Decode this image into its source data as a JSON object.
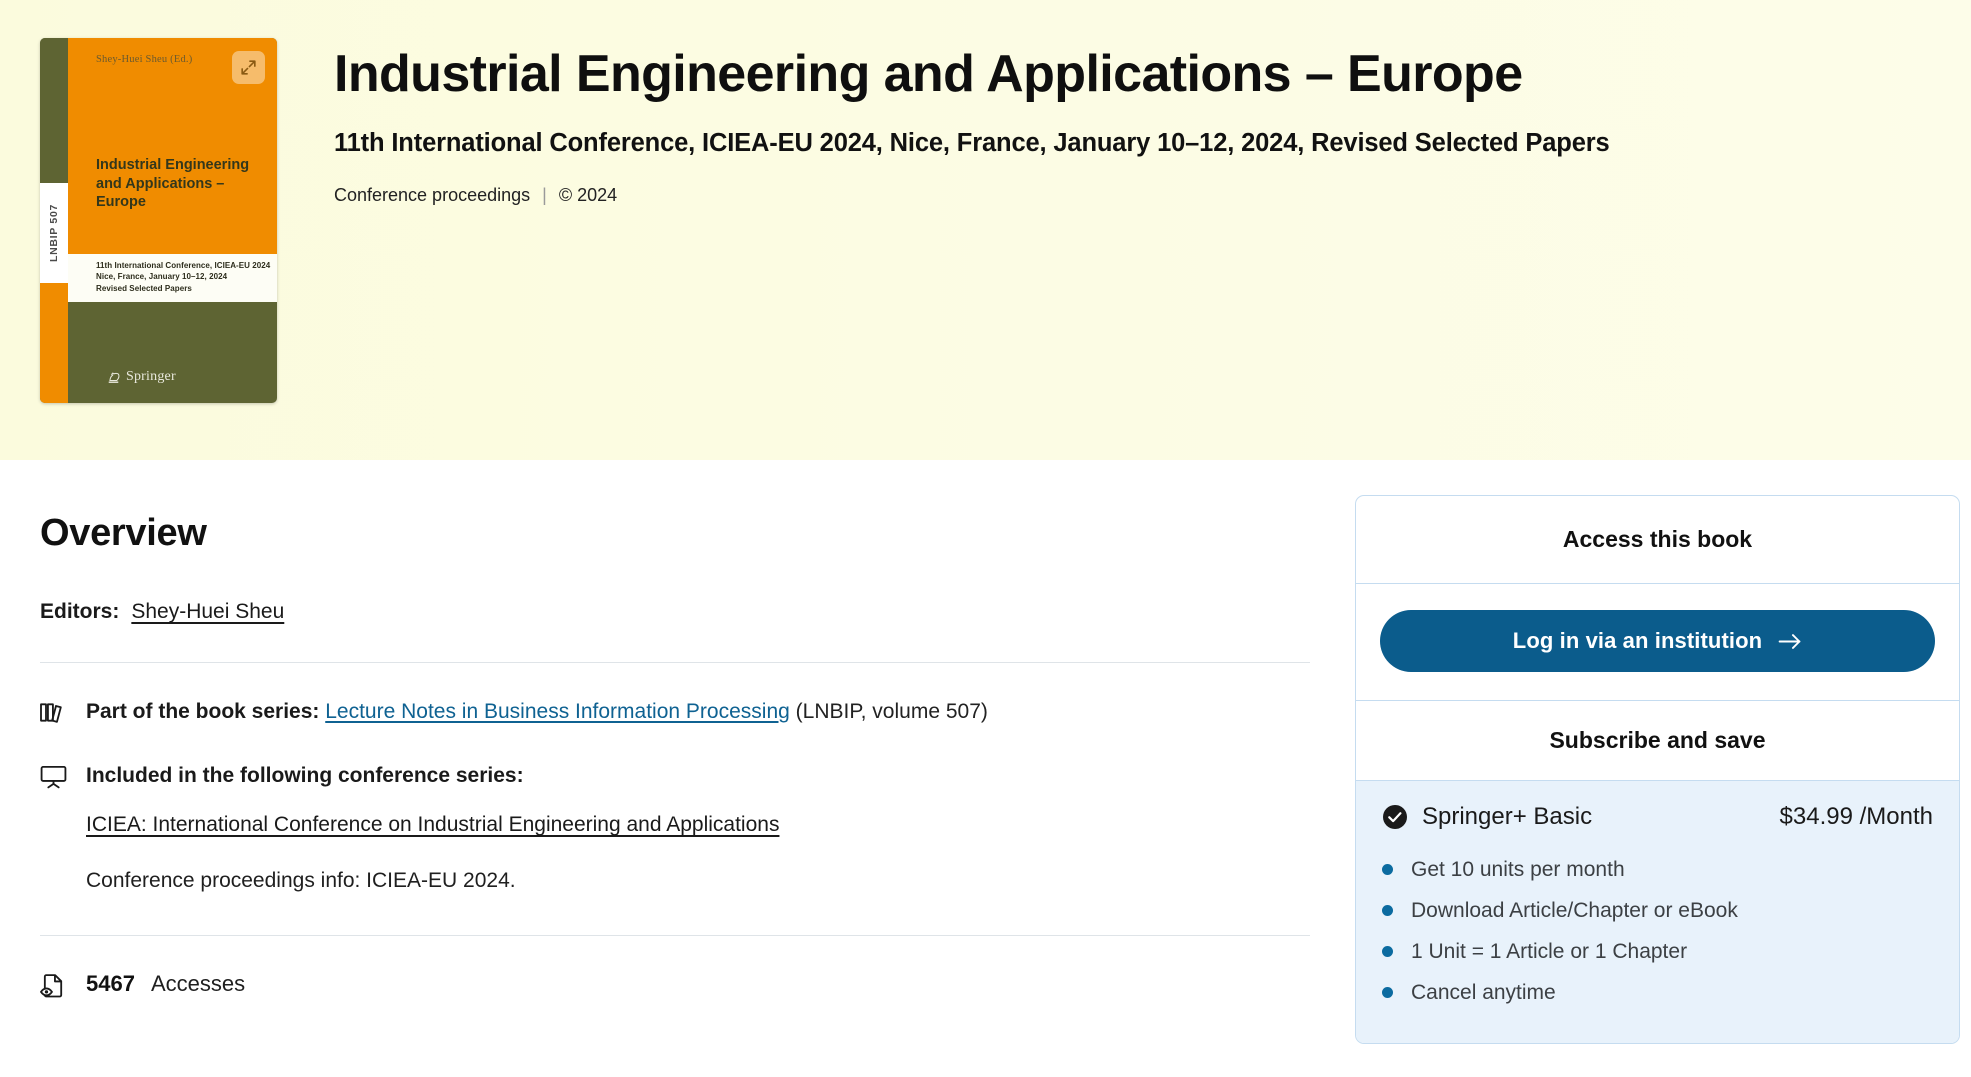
{
  "hero": {
    "title": "Industrial Engineering and Applications – Europe",
    "subtitle": "11th International Conference, ICIEA-EU 2024, Nice, France, January 10–12, 2024, Revised Selected Papers",
    "type_label": "Conference proceedings",
    "separator": "|",
    "copyright": "© 2024",
    "expand_icon": "expand-arrows-icon"
  },
  "cover": {
    "editor_credit": "Shey-Huei Sheu (Ed.)",
    "spine_label": "LNBIP 507",
    "title": "Industrial Engineering and Applications – Europe",
    "band_line1": "11th International Conference, ICIEA-EU 2024",
    "band_line2": "Nice, France, January 10–12, 2024",
    "band_line3": "Revised Selected Papers",
    "publisher": "Springer",
    "colors": {
      "orange": "#f08c00",
      "olive": "#5e6433",
      "band": "#fdfdf5"
    }
  },
  "overview": {
    "heading": "Overview",
    "editors_label": "Editors:",
    "editors": "Shey-Huei Sheu",
    "book_series": {
      "icon": "books-icon",
      "label": "Part of the book series:",
      "link": "Lecture Notes in Business Information Processing",
      "suffix": "(LNBIP, volume 507)"
    },
    "conference_series": {
      "icon": "presentation-screen-icon",
      "label": "Included in the following conference series:",
      "link": "ICIEA: International Conference on Industrial Engineering and Applications",
      "info": "Conference proceedings info: ICIEA-EU 2024."
    },
    "accesses": {
      "icon": "document-views-icon",
      "count": "5467",
      "label": "Accesses"
    }
  },
  "access_card": {
    "header": "Access this book",
    "login_button": "Log in via an institution",
    "login_button_icon": "arrow-right-icon",
    "subscribe_header": "Subscribe and save",
    "plan": {
      "check_icon": "check-circle-icon",
      "name": "Springer+ Basic",
      "price": "$34.99 /Month",
      "features": [
        "Get 10 units per month",
        "Download Article/Chapter or eBook",
        "1 Unit = 1 Article or 1 Chapter",
        "Cancel anytime"
      ]
    },
    "colors": {
      "button": "#0b5c8c",
      "panel": "#e8f2fb",
      "border": "#c5dcf0",
      "bullet": "#0b6ba0"
    }
  }
}
